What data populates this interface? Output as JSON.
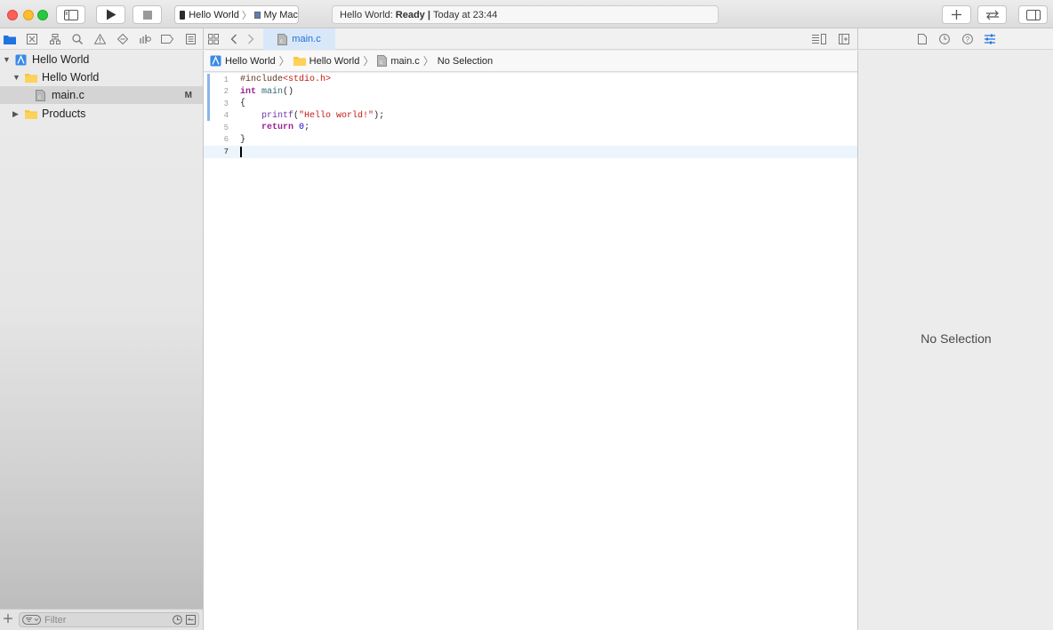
{
  "toolbar": {
    "scheme_target": "Hello World",
    "scheme_device": "My Mac",
    "activity_prefix": "Hello World:",
    "activity_status": "Ready",
    "activity_separator": "|",
    "activity_time": "Today at 23:44"
  },
  "navigator": {
    "items": [
      {
        "label": "Hello World",
        "type": "project",
        "expanded": true
      },
      {
        "label": "Hello World",
        "type": "folder",
        "expanded": true
      },
      {
        "label": "main.c",
        "type": "file",
        "badge": "M",
        "selected": true
      },
      {
        "label": "Products",
        "type": "folder",
        "expanded": false
      }
    ],
    "filter_placeholder": "Filter"
  },
  "editor": {
    "tab_label": "main.c",
    "jumpbar": [
      "Hello World",
      "Hello World",
      "main.c",
      "No Selection"
    ],
    "line_numbers": [
      "1",
      "2",
      "3",
      "4",
      "5",
      "6",
      "7"
    ],
    "lines": [
      "#include<stdio.h>",
      "int main()",
      "{",
      "    printf(\"Hello world!\");",
      "    return 0;",
      "}",
      ""
    ],
    "current_line": 7
  },
  "inspector": {
    "empty_label": "No Selection"
  },
  "colors": {
    "accent": "#1f6fd8",
    "keyword": "#9b2393",
    "string": "#c41a16",
    "number": "#1c00cf"
  },
  "icons": [
    "play-icon",
    "stop-icon",
    "folder-icon",
    "search-icon",
    "warning-icon",
    "plus-icon",
    "swap-icon",
    "inspector-toggle-icon",
    "navigator-toggle-icon"
  ]
}
